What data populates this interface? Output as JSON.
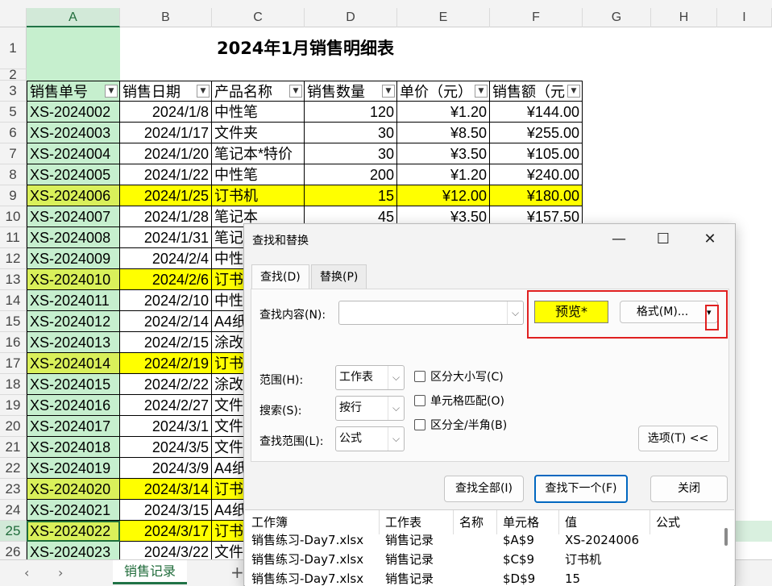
{
  "spreadsheet": {
    "columns": [
      "A",
      "B",
      "C",
      "D",
      "E",
      "F",
      "G",
      "H",
      "I"
    ],
    "title": "2024年1月销售明细表",
    "headers": [
      "销售单号",
      "销售日期",
      "产品名称",
      "销售数量",
      "单价（元）",
      "销售额（元"
    ],
    "rows": [
      {
        "num": "5",
        "id": "XS-2024002",
        "date": "2024/1/8",
        "product": "中性笔",
        "qty": "120",
        "price": "¥1.20",
        "amount": "¥144.00"
      },
      {
        "num": "6",
        "id": "XS-2024003",
        "date": "2024/1/17",
        "product": "文件夹",
        "qty": "30",
        "price": "¥8.50",
        "amount": "¥255.00"
      },
      {
        "num": "7",
        "id": "XS-2024004",
        "date": "2024/1/20",
        "product": "笔记本*特价",
        "qty": "30",
        "price": "¥3.50",
        "amount": "¥105.00"
      },
      {
        "num": "8",
        "id": "XS-2024005",
        "date": "2024/1/22",
        "product": "中性笔",
        "qty": "200",
        "price": "¥1.20",
        "amount": "¥240.00"
      },
      {
        "num": "9",
        "id": "XS-2024006",
        "date": "2024/1/25",
        "product": "订书机",
        "qty": "15",
        "price": "¥12.00",
        "amount": "¥180.00"
      },
      {
        "num": "10",
        "id": "XS-2024007",
        "date": "2024/1/28",
        "product": "笔记本",
        "qty": "45",
        "price": "¥3.50",
        "amount": "¥157.50"
      },
      {
        "num": "11",
        "id": "XS-2024008",
        "date": "2024/1/31",
        "product": "笔记"
      },
      {
        "num": "12",
        "id": "XS-2024009",
        "date": "2024/2/4",
        "product": "中性"
      },
      {
        "num": "13",
        "id": "XS-2024010",
        "date": "2024/2/6",
        "product": "订书"
      },
      {
        "num": "14",
        "id": "XS-2024011",
        "date": "2024/2/10",
        "product": "中性"
      },
      {
        "num": "15",
        "id": "XS-2024012",
        "date": "2024/2/14",
        "product": "A4纸"
      },
      {
        "num": "16",
        "id": "XS-2024013",
        "date": "2024/2/15",
        "product": "涂改"
      },
      {
        "num": "17",
        "id": "XS-2024014",
        "date": "2024/2/19",
        "product": "订书"
      },
      {
        "num": "18",
        "id": "XS-2024015",
        "date": "2024/2/22",
        "product": "涂改"
      },
      {
        "num": "19",
        "id": "XS-2024016",
        "date": "2024/2/27",
        "product": "文件"
      },
      {
        "num": "20",
        "id": "XS-2024017",
        "date": "2024/3/1",
        "product": "文件"
      },
      {
        "num": "21",
        "id": "XS-2024018",
        "date": "2024/3/5",
        "product": "文件"
      },
      {
        "num": "22",
        "id": "XS-2024019",
        "date": "2024/3/9",
        "product": "A4纸"
      },
      {
        "num": "23",
        "id": "XS-2024020",
        "date": "2024/3/14",
        "product": "订书"
      },
      {
        "num": "24",
        "id": "XS-2024021",
        "date": "2024/3/15",
        "product": "A4纸"
      },
      {
        "num": "25",
        "id": "XS-2024022",
        "date": "2024/3/17",
        "product": "订书"
      },
      {
        "num": "26",
        "id": "XS-2024023",
        "date": "2024/3/22",
        "product": "文件"
      }
    ],
    "highlight_rows": [
      "9",
      "13",
      "17",
      "23",
      "25"
    ],
    "active_row": "25",
    "highlight_color": "#ffff00",
    "sheet_tab": "销售记录",
    "add_sheet": "+",
    "prev_sheet": "‹",
    "next_sheet": "›"
  },
  "dialog": {
    "title": "查找和替换",
    "minimize": "—",
    "maximize": "☐",
    "close": "✕",
    "tabs": [
      "查找(D)",
      "替换(P)"
    ],
    "find_label": "查找内容(N):",
    "find_value": "",
    "preview": "预览*",
    "format_button": "格式(M)...",
    "format_arrow": "▾",
    "scope_label": "范围(H):",
    "scope_value": "工作表",
    "search_label": "搜索(S):",
    "search_value": "按行",
    "lookin_label": "查找范围(L):",
    "lookin_value": "公式",
    "options": [
      "区分大小写(C)",
      "单元格匹配(O)",
      "区分全/半角(B)"
    ],
    "options_button": "选项(T) <<",
    "find_all": "查找全部(I)",
    "find_next": "查找下一个(F)",
    "close_button": "关闭",
    "results": {
      "headers": [
        "工作簿",
        "工作表",
        "名称",
        "单元格",
        "值",
        "公式"
      ],
      "rows": [
        [
          "销售练习-Day7.xlsx",
          "销售记录",
          "",
          "$A$9",
          "XS-2024006",
          ""
        ],
        [
          "销售练习-Day7.xlsx",
          "销售记录",
          "",
          "$C$9",
          "订书机",
          ""
        ],
        [
          "销售练习-Day7.xlsx",
          "销售记录",
          "",
          "$D$9",
          "15",
          ""
        ]
      ]
    }
  }
}
